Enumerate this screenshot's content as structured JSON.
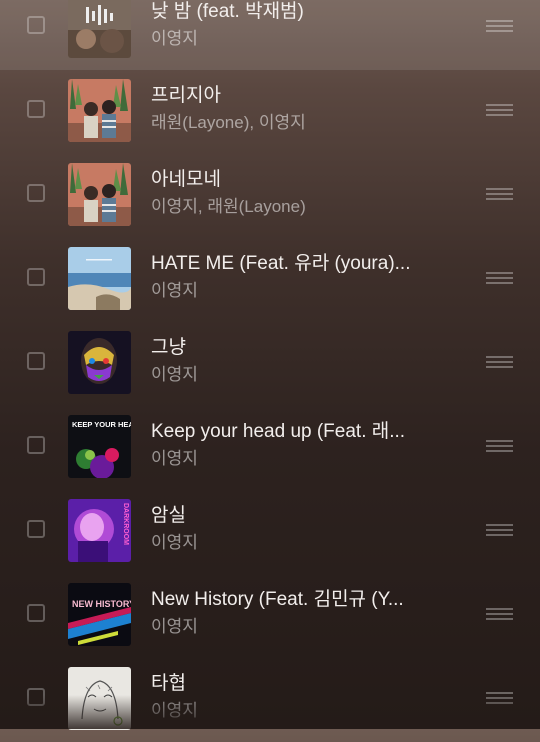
{
  "playlist": {
    "items": [
      {
        "title": "낮 밤 (feat. 박재범)",
        "artist": "이영지",
        "art": "album-art-nat-bam"
      },
      {
        "title": "프리지아",
        "artist": "래원(Layone), 이영지",
        "art": "album-art-freesia"
      },
      {
        "title": "아네모네",
        "artist": "이영지, 래원(Layone)",
        "art": "album-art-anemone"
      },
      {
        "title": "HATE ME (Feat. 유라 (youra)...",
        "artist": "이영지",
        "art": "album-art-beach"
      },
      {
        "title": "그냥",
        "artist": "이영지",
        "art": "album-art-painted-face"
      },
      {
        "title": "Keep your head up (Feat. 래...",
        "artist": "이영지",
        "art": "album-art-keep-your-head-up"
      },
      {
        "title": "암실",
        "artist": "이영지",
        "art": "album-art-darkroom"
      },
      {
        "title": "New History (Feat. 김민규 (Y...",
        "artist": "이영지",
        "art": "album-art-new-history"
      },
      {
        "title": "타협",
        "artist": "이영지",
        "art": "album-art-sketch"
      }
    ]
  },
  "artwork_text": {
    "keep_your_head_up": "KEEP YOUR HEAD UP",
    "darkroom": "DARKROOM",
    "new_history": "NEW HISTORY"
  },
  "colors": {
    "background_top": "#6e5b52",
    "background_bottom": "#241b18",
    "title_text": "#f2eeec",
    "artist_text": "rgba(255,255,255,0.52)",
    "playing_row_highlight": "rgba(255,255,255,0.10)"
  }
}
